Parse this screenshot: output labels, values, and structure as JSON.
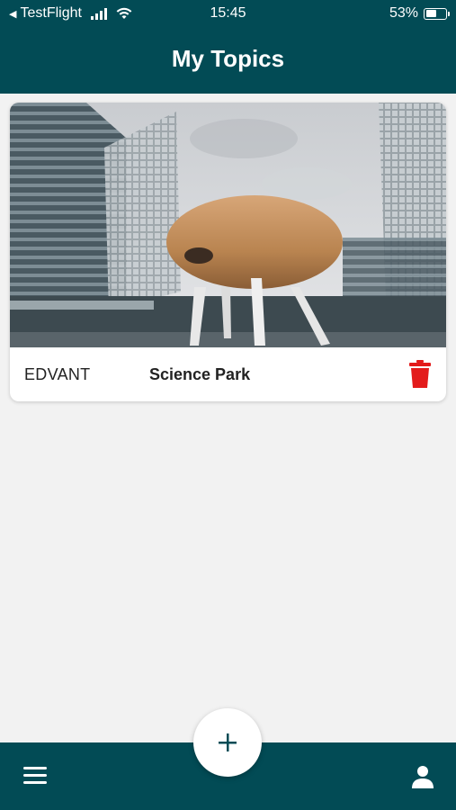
{
  "status_bar": {
    "back_arrow": "◀",
    "carrier": "TestFlight",
    "time": "15:45",
    "battery_percent": "53%",
    "battery_level": 0.53
  },
  "header": {
    "title": "My Topics"
  },
  "topics": [
    {
      "category": "EDVANT",
      "title": "Science Park",
      "image_icon": "science-park-photo"
    }
  ],
  "icons": {
    "delete": "trash-icon",
    "add": "plus-icon",
    "menu": "hamburger-icon",
    "profile": "person-icon"
  },
  "colors": {
    "primary": "#024b55",
    "background": "#f2f2f2",
    "delete": "#e31b1b",
    "card": "#ffffff"
  }
}
